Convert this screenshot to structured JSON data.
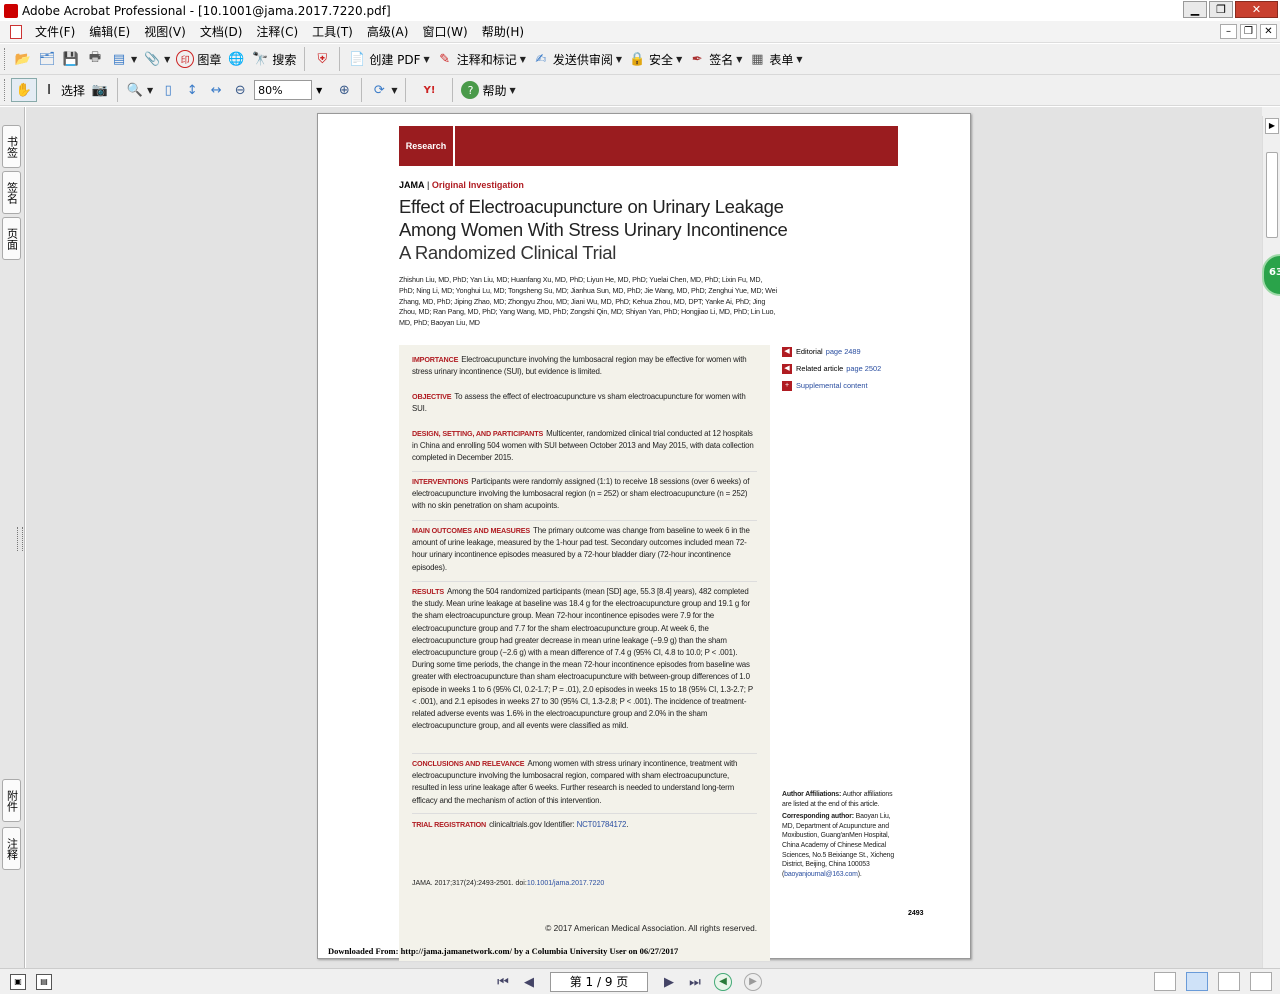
{
  "window": {
    "title": "Adobe Acrobat Professional - [10.1001@jama.2017.7220.pdf]"
  },
  "menu": [
    "文件(F)",
    "编辑(E)",
    "视图(V)",
    "文档(D)",
    "注释(C)",
    "工具(T)",
    "高级(A)",
    "窗口(W)",
    "帮助(H)"
  ],
  "toolbar1": {
    "seal": "图章",
    "search": "搜索",
    "create_pdf": "创建 PDF",
    "comment": "注释和标记",
    "send_review": "发送供审阅",
    "security": "安全",
    "sign": "签名",
    "forms": "表单"
  },
  "toolbar2": {
    "select": "选择",
    "zoom_value": "80%",
    "help": "帮助"
  },
  "left_tabs": [
    "书签",
    "签名",
    "页面",
    "附件",
    "注释"
  ],
  "floating_badge": "63",
  "pdf": {
    "banner": "Research",
    "journal": "JAMA",
    "section": "Original Investigation",
    "title": "Effect of Electroacupuncture on Urinary Leakage Among Women With Stress Urinary Incontinence",
    "subtitle": "A Randomized Clinical Trial",
    "authors": "Zhishun Liu, MD, PhD; Yan Liu, MD; Huanfang Xu, MD, PhD; Liyun He, MD, PhD; Yuelai Chen, MD, PhD; Lixin Fu, MD, PhD; Ning Li, MD; Yonghui Lu, MD; Tongsheng Su, MD; Jianhua Sun, MD, PhD; Jie Wang, MD, PhD; Zenghui Yue, MD; Wei Zhang, MD, PhD; Jiping Zhao, MD; Zhongyu Zhou, MD; Jiani Wu, MD, PhD; Kehua Zhou, MD, DPT; Yanke Ai, PhD; Jing Zhou, MD; Ran Pang, MD, PhD; Yang Wang, MD, PhD; Zongshi Qin, MD; Shiyan Yan, PhD; Hongjiao Li, MD, PhD; Lin Luo, MD, PhD; Baoyan Liu, MD",
    "abstract": {
      "importance_h": "IMPORTANCE",
      "importance": "Electroacupuncture involving the lumbosacral region may be effective for women with stress urinary incontinence (SUI), but evidence is limited.",
      "objective_h": "OBJECTIVE",
      "objective": "To assess the effect of electroacupuncture vs sham electroacupuncture for women with SUI.",
      "design_h": "DESIGN, SETTING, AND PARTICIPANTS",
      "design": "Multicenter, randomized clinical trial conducted at 12 hospitals in China and enrolling 504 women with SUI between October 2013 and May 2015, with data collection completed in December 2015.",
      "interventions_h": "INTERVENTIONS",
      "interventions": "Participants were randomly assigned (1:1) to receive 18 sessions (over 6 weeks) of electroacupuncture involving the lumbosacral region (n = 252) or sham electroacupuncture (n = 252) with no skin penetration on sham acupoints.",
      "outcomes_h": "MAIN OUTCOMES AND MEASURES",
      "outcomes": "The primary outcome was change from baseline to week 6 in the amount of urine leakage, measured by the 1-hour pad test. Secondary outcomes included mean 72-hour urinary incontinence episodes measured by a 72-hour bladder diary (72-hour incontinence episodes).",
      "results_h": "RESULTS",
      "results": "Among the 504 randomized participants (mean [SD] age, 55.3 [8.4] years), 482 completed the study. Mean urine leakage at baseline was 18.4 g for the electroacupuncture group and 19.1 g for the sham electroacupuncture group. Mean 72-hour incontinence episodes were 7.9 for the electroacupuncture group and 7.7 for the sham electroacupuncture group. At week 6, the electroacupuncture group had greater decrease in mean urine leakage (−9.9 g) than the sham electroacupuncture group (−2.6 g) with a mean difference of 7.4 g (95% CI, 4.8 to 10.0; P < .001). During some time periods, the change in the mean 72-hour incontinence episodes from baseline was greater with electroacupuncture than sham electroacupuncture with between-group differences of 1.0 episode in weeks 1 to 6 (95% CI, 0.2-1.7; P = .01), 2.0 episodes in weeks 15 to 18 (95% CI, 1.3-2.7; P < .001), and 2.1 episodes in weeks 27 to 30 (95% CI, 1.3-2.8; P < .001). The incidence of treatment-related adverse events was 1.6% in the electroacupuncture group and 2.0% in the sham electroacupuncture group, and all events were classified as mild.",
      "conclusions_h": "CONCLUSIONS AND RELEVANCE",
      "conclusions": "Among women with stress urinary incontinence, treatment with electroacupuncture involving the lumbosacral region, compared with sham electroacupuncture, resulted in less urine leakage after 6 weeks. Further research is needed to understand long-term efficacy and the mechanism of action of this intervention.",
      "trial_h": "TRIAL REGISTRATION",
      "trial": "clinicaltrials.gov Identifier:",
      "trial_id": "NCT01784172",
      "citation": "JAMA. 2017;317(24):2493-2501. doi:",
      "doi": "10.1001/jama.2017.7220",
      "copyright": "© 2017 American Medical Association. All rights reserved."
    },
    "side": {
      "editorial": "Editorial",
      "editorial_page": "page 2489",
      "related": "Related article",
      "related_page": "page 2502",
      "supplemental": "Supplemental content"
    },
    "affil_h": "Author Affiliations:",
    "affil": "Author affiliations are listed at the end of this article.",
    "corr_h": "Corresponding author:",
    "corr": "Baoyan Liu, MD, Department of Acupuncture and Moxibustion, Guang'anMen Hospital, China Academy of Chinese Medical Sciences, No.5 Beixiange St., Xicheng District, Beijing, China 100053 (",
    "corr_email": "baoyanjournal@163.com",
    "corr_end": ").",
    "page_number": "2493",
    "downloaded": "Downloaded From: http://jama.jamanetwork.com/ by a Columbia University User  on 06/27/2017"
  },
  "status": {
    "page_indicator": "第 1 / 9 页"
  }
}
